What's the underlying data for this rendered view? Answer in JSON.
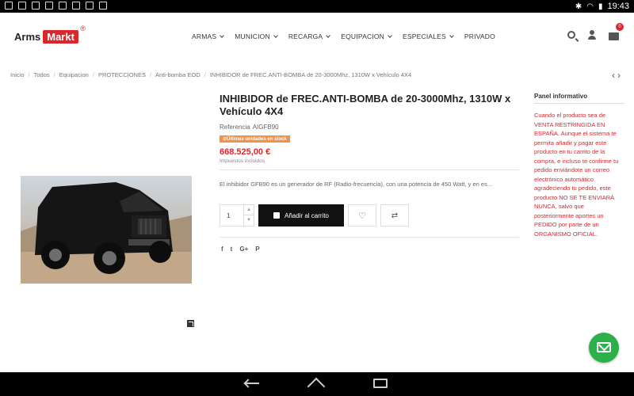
{
  "status_bar": {
    "time": "19:43"
  },
  "logo": {
    "arms": "Arms",
    "markt": "Markt",
    "registered": "®"
  },
  "nav": [
    "ARMAS",
    "MUNICION",
    "RECARGA",
    "EQUIPACION",
    "ESPECIALES",
    "PRIVADO"
  ],
  "cart": {
    "count": "0"
  },
  "breadcrumb": [
    "Inicio",
    "Todos",
    "Equipacion",
    "PROTECCIONES",
    "Anti-bomba EOD",
    "INHIBIDOR de FREC.ANTI-BOMBA de 20-3000Mhz, 1310W x Vehículo 4X4"
  ],
  "product": {
    "title": "INHIBIDOR de FREC.ANTI-BOMBA de 20-3000Mhz, 1310W x Vehículo 4X4",
    "reference_label": "Referencia",
    "reference": "AIGFB90",
    "stock_badge": "Últimas unidades en stock",
    "price": "668.525,00 €",
    "tax": "Impuestos incluidos",
    "description": "El inhibidor GFB90 es un generador de RF (Radio-frecuencia), con una potencia de 450 Watt, y en es...",
    "quantity": "1",
    "add_to_cart": "Añadir al carrito"
  },
  "share": {
    "facebook": "f",
    "twitter": "t",
    "google": "G+",
    "pinterest": "P"
  },
  "panel": {
    "title": "Panel informativo",
    "text": "Cuando el producto sea de VENTA RESTRINGIDA EN ESPAÑA. Aunque el sistema te permita añadir y pagar este producto en tu carrito de la compra, e incluso te confirme tu pedido enviándote un correo electrónico automático agradeciendo tu pedido, este producto NO SE TE ENVIARÁ NUNCA, salvo que posteriormente aportes un PEDIDO por parte de un ORGANISMO OFICIAL."
  },
  "colors": {
    "brand_red": "#d9272e",
    "fab_green": "#2bb04a",
    "badge_orange": "#f1914a"
  }
}
